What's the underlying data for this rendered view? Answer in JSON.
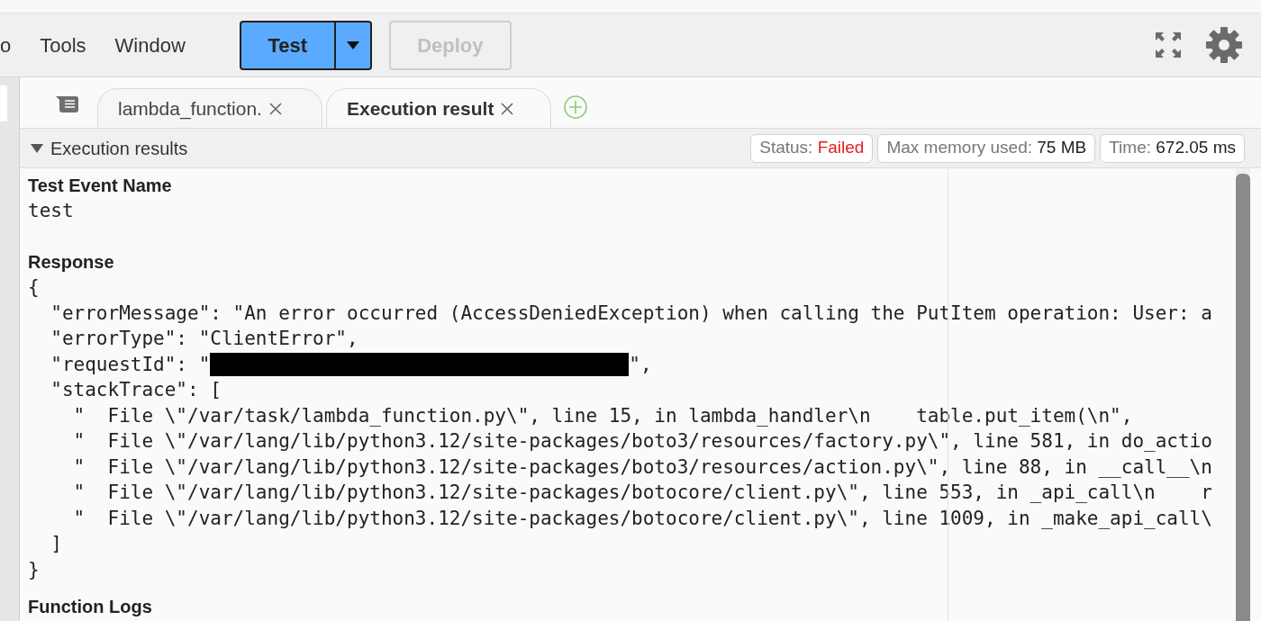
{
  "menu": [
    {
      "label": "o"
    },
    {
      "label": "Tools"
    },
    {
      "label": "Window"
    }
  ],
  "toolbar": {
    "test_button": {
      "label": "Test"
    },
    "deploy_button": {
      "label": "Deploy",
      "disabled": true
    }
  },
  "tabs": [
    {
      "label": "lambda_function.",
      "selected": false
    },
    {
      "label": "Execution result",
      "selected": true
    }
  ],
  "panel": {
    "title": "Execution results",
    "expanded": true,
    "badges": [
      {
        "label": "Status:",
        "value": "Failed",
        "kind": "error"
      },
      {
        "label": "Max memory used:",
        "value": "75 MB",
        "kind": "normal"
      },
      {
        "label": "Time:",
        "value": "672.05 ms",
        "kind": "normal"
      }
    ]
  },
  "test_event": {
    "heading": "Test Event Name",
    "value": "test"
  },
  "response": {
    "heading": "Response",
    "lines": [
      {
        "text": "{"
      },
      {
        "text": "  \"errorMessage\": \"An error occurred (AccessDeniedException) when calling the PutItem operation: User: a"
      },
      {
        "text": "  \"errorType\": \"ClientError\","
      },
      {
        "text": "  \"requestId\": \"",
        "redacted": true,
        "suffix": "\","
      },
      {
        "text": "  \"stackTrace\": ["
      },
      {
        "text": "    \"  File \\\"/var/task/lambda_function.py\\\", line 15, in lambda_handler\\n    table.put_item(\\n\","
      },
      {
        "text": "    \"  File \\\"/var/lang/lib/python3.12/site-packages/boto3/resources/factory.py\\\", line 581, in do_actio"
      },
      {
        "text": "    \"  File \\\"/var/lang/lib/python3.12/site-packages/boto3/resources/action.py\\\", line 88, in __call__\\n"
      },
      {
        "text": "    \"  File \\\"/var/lang/lib/python3.12/site-packages/botocore/client.py\\\", line 553, in _api_call\\n    r"
      },
      {
        "text": "    \"  File \\\"/var/lang/lib/python3.12/site-packages/botocore/client.py\\\", line 1009, in _make_api_call\\"
      },
      {
        "text": "  ]"
      },
      {
        "text": "}"
      }
    ]
  },
  "function_logs": {
    "heading": "Function Logs"
  }
}
